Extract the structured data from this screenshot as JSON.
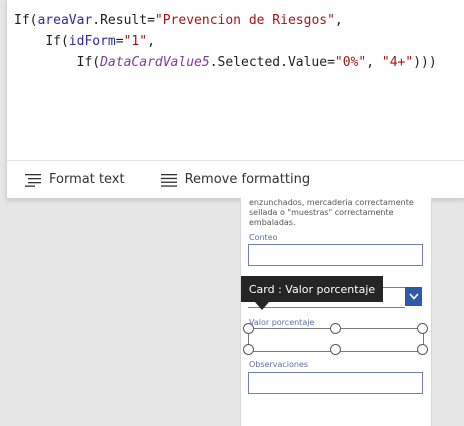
{
  "formula": {
    "line1": {
      "if1": "If(",
      "var1": "areaVar",
      "prop1": ".Result=",
      "str1": "\"Prevencion de Riesgos\"",
      "end1": ","
    },
    "line2": {
      "indent": "    ",
      "if2": "If(",
      "var2": "idForm",
      "eq2": "=",
      "str2": "\"1\"",
      "end2": ","
    },
    "line3": {
      "indent": "        ",
      "if3": "If(",
      "ctl3": "DataCardValue5",
      "prop3": ".Selected.Value=",
      "str3a": "\"0%\"",
      "sep3": ", ",
      "str3b": "\"4+\"",
      "end3": ")))"
    }
  },
  "toolbar": {
    "format_text": "Format text",
    "remove_formatting": "Remove formatting"
  },
  "canvas": {
    "description": "enzunchados, mercaderia correctamente sellada o \"muestras\" correctamente embaladas.",
    "conteo_label": "Conteo",
    "valor_label": "Valor porcentaje",
    "observaciones_label": "Observaciones"
  },
  "tooltip": {
    "text": "Card : Valor porcentaje"
  }
}
